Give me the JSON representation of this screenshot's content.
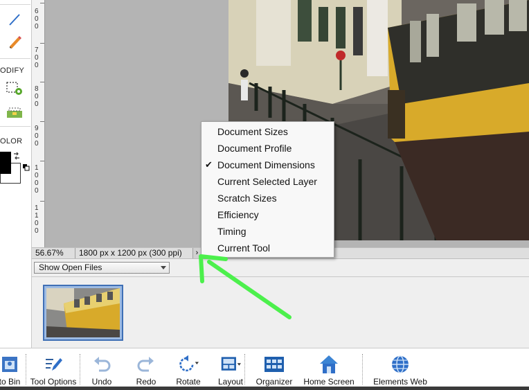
{
  "tool_strip": {
    "sections": [
      {
        "label": "ODIFY"
      },
      {
        "label": "OLOR"
      }
    ],
    "tools": [
      {
        "icon": "line-tool-icon"
      },
      {
        "icon": "pencil-icon"
      },
      {
        "icon": "recompose-icon"
      },
      {
        "icon": "straighten-icon"
      }
    ],
    "colors": {
      "foreground": "#000000",
      "background": "#ffffff"
    }
  },
  "ruler": {
    "labels": [
      {
        "digits": [
          "6",
          "0",
          "0"
        ]
      },
      {
        "digits": [
          "7",
          "0",
          "0"
        ]
      },
      {
        "digits": [
          "8",
          "0",
          "0"
        ]
      },
      {
        "digits": [
          "9",
          "0",
          "0"
        ]
      },
      {
        "digits": [
          "1",
          "0",
          "0",
          "0"
        ]
      },
      {
        "digits": [
          "1",
          "1",
          "0",
          "0"
        ]
      }
    ]
  },
  "status_bar": {
    "zoom": "56.67%",
    "info": "1800 px x 1200 px (300 ppi)",
    "arrow": "›"
  },
  "context_menu": {
    "items": [
      {
        "label": "Document Sizes",
        "checked": false
      },
      {
        "label": "Document Profile",
        "checked": false
      },
      {
        "label": "Document Dimensions",
        "checked": true,
        "check_mark": "✔"
      },
      {
        "label": "Current Selected Layer",
        "checked": false
      },
      {
        "label": "Scratch Sizes",
        "checked": false
      },
      {
        "label": "Efficiency",
        "checked": false
      },
      {
        "label": "Timing",
        "checked": false
      },
      {
        "label": "Current Tool",
        "checked": false
      }
    ]
  },
  "photo_bin": {
    "dropdown_value": "Show Open Files"
  },
  "taskbar": {
    "buttons": [
      {
        "label": "to Bin",
        "icon": "photo-bin-icon"
      },
      {
        "label": "Tool Options",
        "icon": "tool-options-icon"
      },
      {
        "label": "Undo",
        "icon": "undo-icon"
      },
      {
        "label": "Redo",
        "icon": "redo-icon"
      },
      {
        "label": "Rotate",
        "icon": "rotate-icon"
      },
      {
        "label": "Layout",
        "icon": "layout-icon"
      },
      {
        "label": "Organizer",
        "icon": "organizer-icon"
      },
      {
        "label": "Home Screen",
        "icon": "home-screen-icon"
      },
      {
        "label": "Elements Web",
        "icon": "elements-web-icon"
      }
    ]
  },
  "colors": {
    "canvas_bg": "#b4b4b4",
    "annotation_arrow": "#4cf04c",
    "thumb_selection": "#3f6fb5",
    "tram_yellow": "#d8aa2a"
  }
}
